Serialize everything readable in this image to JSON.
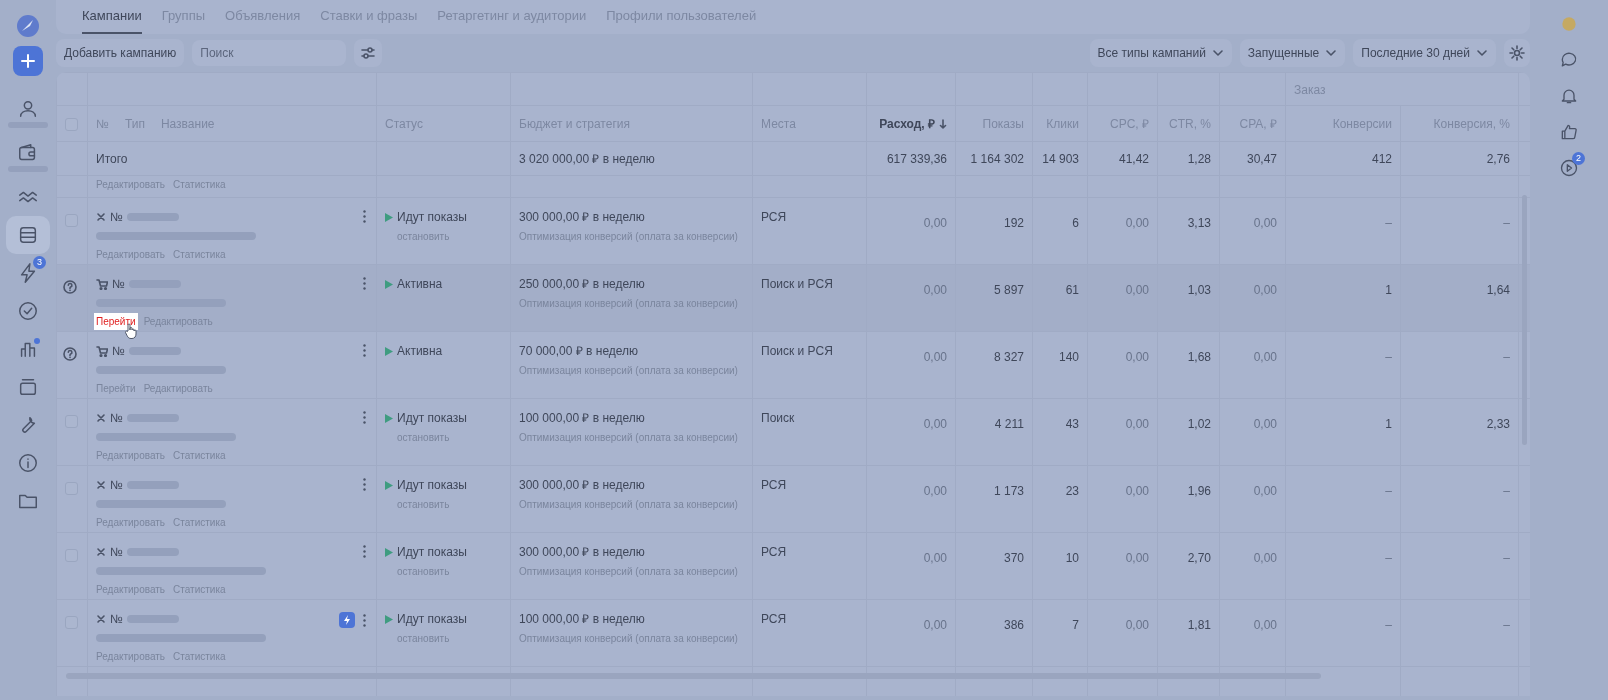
{
  "sidebar": {
    "items": [
      {
        "selected": false,
        "redacted": true,
        "dot": false
      },
      {
        "selected": false,
        "redacted": true,
        "dot": false
      },
      {
        "selected": false,
        "redacted": false,
        "dot": false
      },
      {
        "selected": true,
        "redacted": false,
        "dot": false
      },
      {
        "selected": false,
        "redacted": false,
        "dot": false,
        "badge": "3"
      },
      {
        "selected": false,
        "redacted": false,
        "dot": false
      },
      {
        "selected": false,
        "redacted": false,
        "dot": true
      },
      {
        "selected": false,
        "redacted": false,
        "dot": false
      },
      {
        "selected": false,
        "redacted": false,
        "dot": false
      },
      {
        "selected": false,
        "redacted": false,
        "dot": false
      },
      {
        "selected": false,
        "redacted": false,
        "dot": false
      }
    ]
  },
  "tabs": [
    {
      "label": "Кампании",
      "selected": true
    },
    {
      "label": "Группы",
      "selected": false
    },
    {
      "label": "Объявления",
      "selected": false
    },
    {
      "label": "Ставки и фразы",
      "selected": false
    },
    {
      "label": "Ретаргетинг и аудитории",
      "selected": false
    },
    {
      "label": "Профили пользователей",
      "selected": false
    }
  ],
  "toolbar": {
    "add_button": "Добавить кампанию",
    "search": {
      "placeholder": "Поиск"
    },
    "filters": [
      "Все типы кампаний",
      "Запущенные",
      "Последние 30 дней"
    ]
  },
  "table": {
    "select_all": {
      "checked": false
    },
    "group_header": "Заказ",
    "name_headers": [
      "№",
      "Тип",
      "Название"
    ],
    "columns": [
      {
        "label": "Статус",
        "sorted": false
      },
      {
        "label": "Бюджет и стратегия",
        "sorted": false
      },
      {
        "label": "Места",
        "sorted": false
      },
      {
        "label": "Расход, ₽",
        "sorted": true
      },
      {
        "label": "Показы",
        "sorted": false
      },
      {
        "label": "Клики",
        "sorted": false
      },
      {
        "label": "CPC, ₽",
        "sorted": false
      },
      {
        "label": "CTR, %",
        "sorted": false
      },
      {
        "label": "CPA, ₽",
        "sorted": false
      },
      {
        "label": "Конверсии",
        "sorted": false
      },
      {
        "label": "Конверсия, %",
        "sorted": false
      }
    ],
    "total": {
      "label": "Итого",
      "budget": "3 020 000,00 ₽ в неделю",
      "metrics": [
        "617 339,36",
        "1 164 302",
        "14 903",
        "41,42",
        "1,28",
        "30,47",
        "412",
        "2,76"
      ]
    },
    "scrolled_row_actions": [
      "Редактировать",
      "Статистика"
    ],
    "rows": [
      {
        "kind": "standard",
        "select": {
          "kind": "checkbox",
          "checked": false
        },
        "hovered": false,
        "number_label": "№",
        "autobudget": false,
        "actions": [
          {
            "label": "Редактировать",
            "highlighted": false
          },
          {
            "label": "Статистика",
            "highlighted": false
          }
        ],
        "status": "Идут показы",
        "status_action": "остановить",
        "budget": "300 000,00 ₽ в неделю",
        "strategy": "Оптимизация конверсий (оплата за конверсии)",
        "places": "РСЯ",
        "metrics": [
          {
            "text": "0,00",
            "muted": true
          },
          {
            "text": "192",
            "muted": false
          },
          {
            "text": "6",
            "muted": false
          },
          {
            "text": "0,00",
            "muted": true
          },
          {
            "text": "3,13",
            "muted": false
          },
          {
            "text": "0,00",
            "muted": true
          },
          {
            "text": "–",
            "muted": true
          },
          {
            "text": "–",
            "muted": true
          }
        ]
      },
      {
        "kind": "shop",
        "select": {
          "kind": "help"
        },
        "hovered": true,
        "number_label": "№",
        "autobudget": false,
        "actions": [
          {
            "label": "Перейти",
            "highlighted": true
          },
          {
            "label": "Редактировать",
            "highlighted": false
          }
        ],
        "status": "Активна",
        "budget": "250 000,00 ₽ в неделю",
        "strategy": "Оптимизация конверсий (оплата за конверсии)",
        "places": "Поиск и РСЯ",
        "metrics": [
          {
            "text": "0,00",
            "muted": true
          },
          {
            "text": "5 897",
            "muted": false
          },
          {
            "text": "61",
            "muted": false
          },
          {
            "text": "0,00",
            "muted": true
          },
          {
            "text": "1,03",
            "muted": false
          },
          {
            "text": "0,00",
            "muted": true
          },
          {
            "text": "1",
            "muted": false
          },
          {
            "text": "1,64",
            "muted": false
          }
        ]
      },
      {
        "kind": "shop",
        "select": {
          "kind": "help"
        },
        "hovered": false,
        "number_label": "№",
        "autobudget": false,
        "actions": [
          {
            "label": "Перейти",
            "highlighted": false
          },
          {
            "label": "Редактировать",
            "highlighted": false
          }
        ],
        "status": "Активна",
        "budget": "70 000,00 ₽ в неделю",
        "strategy": "Оптимизация конверсий (оплата за конверсии)",
        "places": "Поиск и РСЯ",
        "metrics": [
          {
            "text": "0,00",
            "muted": true
          },
          {
            "text": "8 327",
            "muted": false
          },
          {
            "text": "140",
            "muted": false
          },
          {
            "text": "0,00",
            "muted": true
          },
          {
            "text": "1,68",
            "muted": false
          },
          {
            "text": "0,00",
            "muted": true
          },
          {
            "text": "–",
            "muted": true
          },
          {
            "text": "–",
            "muted": true
          }
        ]
      },
      {
        "kind": "standard",
        "select": {
          "kind": "checkbox",
          "checked": false
        },
        "hovered": false,
        "number_label": "№",
        "autobudget": false,
        "actions": [
          {
            "label": "Редактировать",
            "highlighted": false
          },
          {
            "label": "Статистика",
            "highlighted": false
          }
        ],
        "status": "Идут показы",
        "status_action": "остановить",
        "budget": "100 000,00 ₽ в неделю",
        "strategy": "Оптимизация конверсий (оплата за конверсии)",
        "places": "Поиск",
        "metrics": [
          {
            "text": "0,00",
            "muted": true
          },
          {
            "text": "4 211",
            "muted": false
          },
          {
            "text": "43",
            "muted": false
          },
          {
            "text": "0,00",
            "muted": true
          },
          {
            "text": "1,02",
            "muted": false
          },
          {
            "text": "0,00",
            "muted": true
          },
          {
            "text": "1",
            "muted": false
          },
          {
            "text": "2,33",
            "muted": false
          }
        ]
      },
      {
        "kind": "standard",
        "select": {
          "kind": "checkbox",
          "checked": false
        },
        "hovered": false,
        "number_label": "№",
        "autobudget": false,
        "actions": [
          {
            "label": "Редактировать",
            "highlighted": false
          },
          {
            "label": "Статистика",
            "highlighted": false
          }
        ],
        "status": "Идут показы",
        "status_action": "остановить",
        "budget": "300 000,00 ₽ в неделю",
        "strategy": "Оптимизация конверсий (оплата за конверсии)",
        "places": "РСЯ",
        "metrics": [
          {
            "text": "0,00",
            "muted": true
          },
          {
            "text": "1 173",
            "muted": false
          },
          {
            "text": "23",
            "muted": false
          },
          {
            "text": "0,00",
            "muted": true
          },
          {
            "text": "1,96",
            "muted": false
          },
          {
            "text": "0,00",
            "muted": true
          },
          {
            "text": "–",
            "muted": true
          },
          {
            "text": "–",
            "muted": true
          }
        ]
      },
      {
        "kind": "standard",
        "select": {
          "kind": "checkbox",
          "checked": false
        },
        "hovered": false,
        "number_label": "№",
        "autobudget": false,
        "actions": [
          {
            "label": "Редактировать",
            "highlighted": false
          },
          {
            "label": "Статистика",
            "highlighted": false
          }
        ],
        "status": "Идут показы",
        "status_action": "остановить",
        "budget": "300 000,00 ₽ в неделю",
        "strategy": "Оптимизация конверсий (оплата за конверсии)",
        "places": "РСЯ",
        "metrics": [
          {
            "text": "0,00",
            "muted": true
          },
          {
            "text": "370",
            "muted": false
          },
          {
            "text": "10",
            "muted": false
          },
          {
            "text": "0,00",
            "muted": true
          },
          {
            "text": "2,70",
            "muted": false
          },
          {
            "text": "0,00",
            "muted": true
          },
          {
            "text": "–",
            "muted": true
          },
          {
            "text": "–",
            "muted": true
          }
        ]
      },
      {
        "kind": "standard",
        "select": {
          "kind": "checkbox",
          "checked": false
        },
        "hovered": false,
        "number_label": "№",
        "autobudget": true,
        "actions": [
          {
            "label": "Редактировать",
            "highlighted": false
          },
          {
            "label": "Статистика",
            "highlighted": false
          }
        ],
        "status": "Идут показы",
        "status_action": "остановить",
        "budget": "100 000,00 ₽ в неделю",
        "strategy": "Оптимизация конверсий (оплата за конверсии)",
        "places": "РСЯ",
        "metrics": [
          {
            "text": "0,00",
            "muted": true
          },
          {
            "text": "386",
            "muted": false
          },
          {
            "text": "7",
            "muted": false
          },
          {
            "text": "0,00",
            "muted": true
          },
          {
            "text": "1,81",
            "muted": false
          },
          {
            "text": "0,00",
            "muted": true
          },
          {
            "text": "–",
            "muted": true
          },
          {
            "text": "–",
            "muted": true
          }
        ]
      }
    ]
  },
  "right_rail": {
    "play_badge": "2"
  }
}
